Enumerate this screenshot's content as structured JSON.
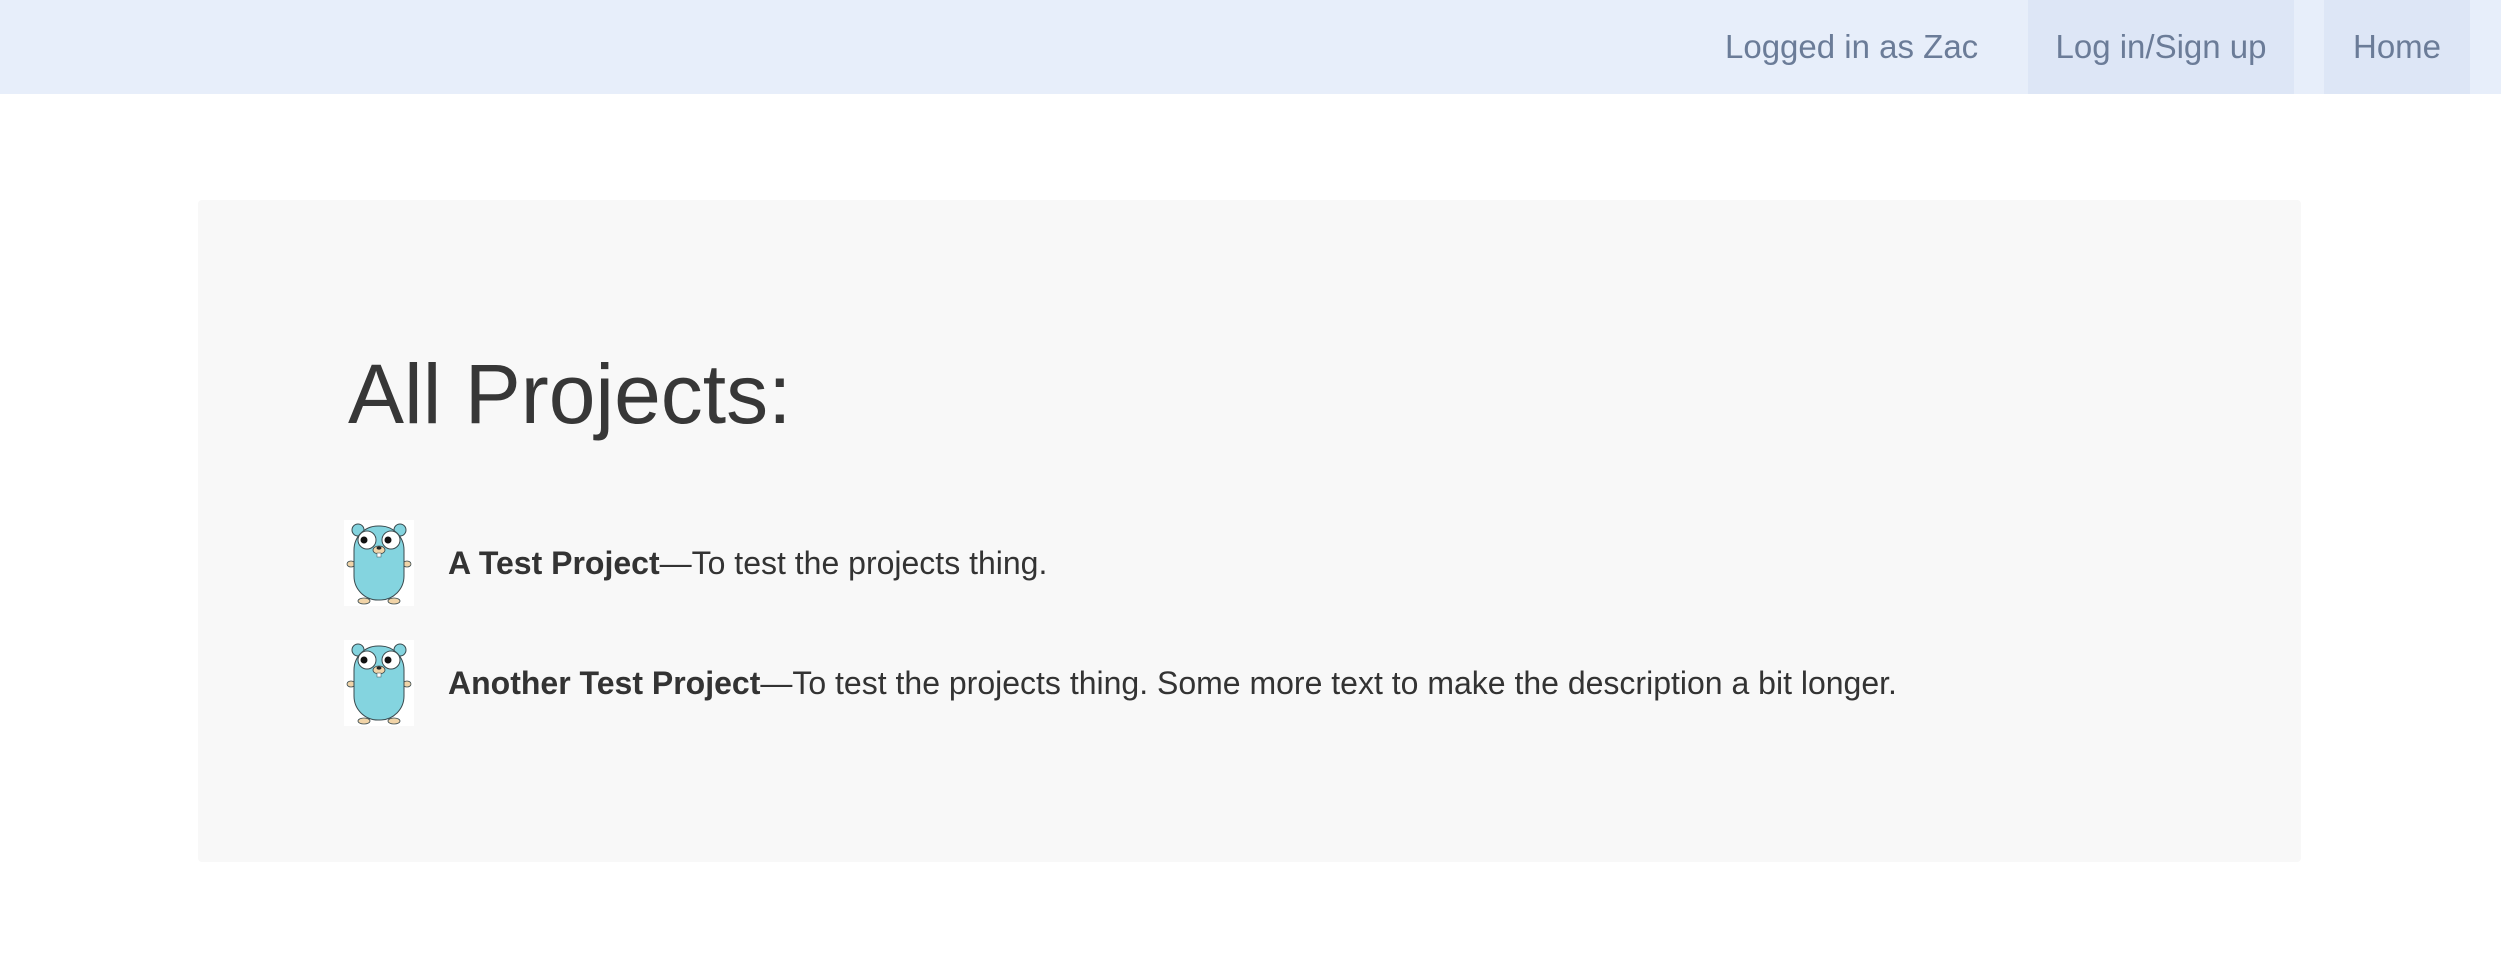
{
  "header": {
    "user_status": "Logged in as Zac",
    "login_label": "Log in/Sign up",
    "home_label": "Home"
  },
  "main": {
    "title": "All Projects:",
    "projects": [
      {
        "name": "A Test Project",
        "separator": "—",
        "description": "To test the projects thing.",
        "icon": "gopher-icon"
      },
      {
        "name": "Another Test Project",
        "separator": "—",
        "description": "To test the projects thing. Some more text to make the description a bit longer.",
        "icon": "gopher-icon"
      }
    ]
  },
  "colors": {
    "header_bg": "#e7eefa",
    "header_button_bg": "#dde6f6",
    "nav_text": "#6b7c98",
    "card_bg": "#f8f8f8",
    "gopher_body": "#84d4df"
  }
}
